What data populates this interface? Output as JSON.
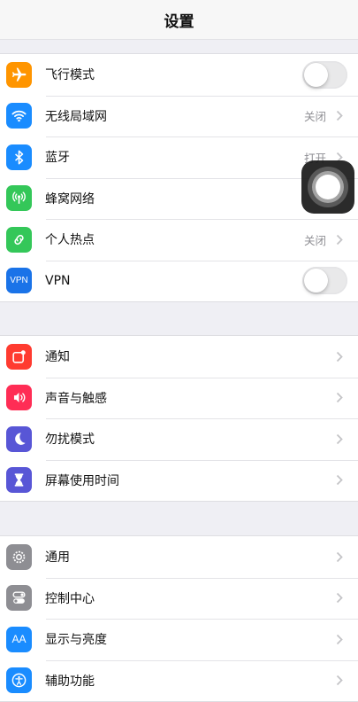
{
  "nav": {
    "title": "设置"
  },
  "group1": {
    "airplane": {
      "label": "飞行模式",
      "icon": "airplane-icon",
      "color": "#ff9500",
      "toggle_on": false
    },
    "wifi": {
      "label": "无线局域网",
      "value": "关闭",
      "icon": "wifi-icon",
      "color": "#1a8cff"
    },
    "bluetooth": {
      "label": "蓝牙",
      "value": "打开",
      "icon": "bluetooth-icon",
      "color": "#1a8cff"
    },
    "cellular": {
      "label": "蜂窝网络",
      "icon": "antenna-icon",
      "color": "#34c759"
    },
    "hotspot": {
      "label": "个人热点",
      "value": "关闭",
      "icon": "hotspot-icon",
      "color": "#34c759"
    },
    "vpn": {
      "label": "VPN",
      "icon_text": "VPN",
      "icon": "vpn-icon",
      "color": "#1a73e8",
      "toggle_on": false
    }
  },
  "group2": {
    "notifications": {
      "label": "通知",
      "icon": "notification-icon",
      "color": "#ff3b30"
    },
    "sounds": {
      "label": "声音与触感",
      "icon": "speaker-icon",
      "color": "#ff2d55"
    },
    "dnd": {
      "label": "勿扰模式",
      "icon": "moon-icon",
      "color": "#5856d6"
    },
    "screentime": {
      "label": "屏幕使用时间",
      "icon": "hourglass-icon",
      "color": "#5856d6"
    }
  },
  "group3": {
    "general": {
      "label": "通用",
      "icon": "gear-icon",
      "color": "#8e8e93"
    },
    "control": {
      "label": "控制中心",
      "icon": "switches-icon",
      "color": "#8e8e93"
    },
    "display": {
      "label": "显示与亮度",
      "icon_text": "AA",
      "icon": "text-size-icon",
      "color": "#1a8cff"
    },
    "accessibility": {
      "label": "辅助功能",
      "icon": "accessibility-icon",
      "color": "#1a8cff"
    }
  }
}
